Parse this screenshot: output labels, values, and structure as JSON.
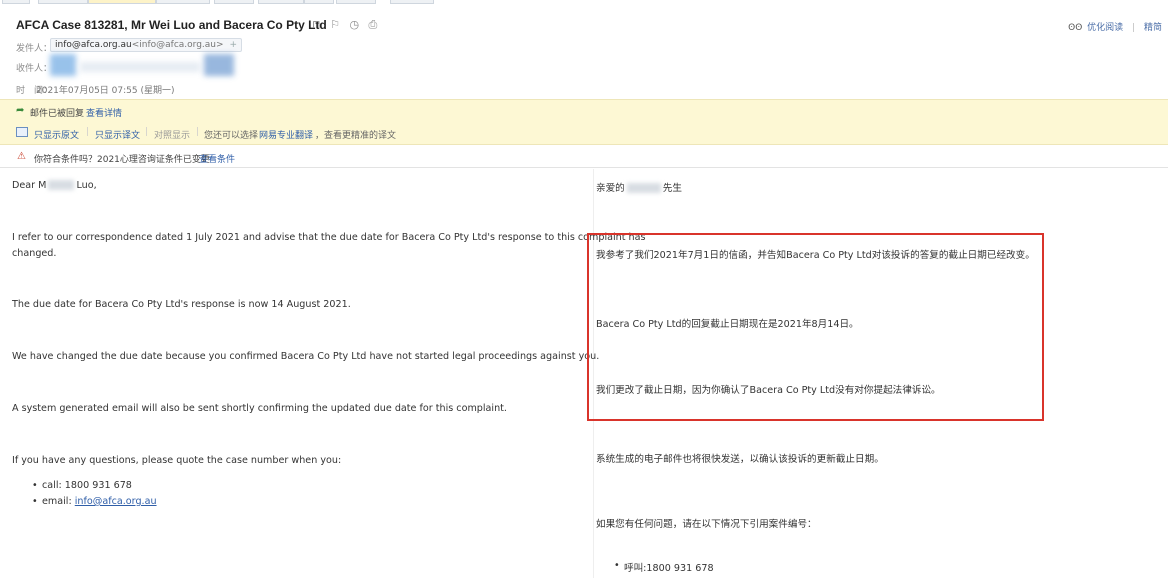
{
  "header": {
    "subject": "AFCA Case 813281, Mr Wei Luo and Bacera Co Pty Ltd",
    "subject_icons": "⊓ ⚐ ◷ ⎙",
    "optimize_read": "优化阅读",
    "simplified": "精简",
    "from_label": "发件人：",
    "from_name": "info@afca.org.au",
    "from_addr": "<info@afca.org.au>",
    "from_plus": "+",
    "to_label": "收件人：",
    "time_label": "时　间：",
    "time_value": "2021年07月05日 07:55 (星期一)"
  },
  "notices": {
    "replied_text": "邮件已被回复",
    "replied_link": "查看详情",
    "only_original": "只显示原文",
    "only_translation": "只显示译文",
    "side_by_side": "对照显示",
    "you_can_choose": "您还可以选择",
    "netease_translate": "网易专业翻译",
    "more_accurate": "，查看更精准的译文",
    "warning_text": "你符合条件吗？2021心理咨询证条件已变更",
    "warning_link": "查看条件"
  },
  "body_en": {
    "greeting_a": "Dear M",
    "greeting_b": "Luo,",
    "p1": "I refer to our correspondence dated 1 July 2021 and advise that the due date for Bacera Co Pty Ltd's response to this complaint has",
    "p1b": "changed.",
    "p2": "The due date for Bacera Co Pty Ltd's response is now 14 August 2021.",
    "p3": "We have changed the due date because you confirmed Bacera Co Pty Ltd have not started legal proceedings against you.",
    "p4": "A system generated email will also be sent shortly confirming the updated due date for this complaint.",
    "p5": "If you have any questions, please quote the case number when you:",
    "call": "call: 1800 931 678",
    "email_label": "email: ",
    "email_link": "info@afca.org.au"
  },
  "body_zh": {
    "greeting_a": "亲爱的",
    "greeting_b": "先生",
    "p1": "我参考了我们2021年7月1日的信函，并告知Bacera Co Pty Ltd对该投诉的答复的截止日期已经改变。",
    "p2": "Bacera Co Pty Ltd的回复截止日期现在是2021年8月14日。",
    "p3": "我们更改了截止日期，因为你确认了Bacera Co Pty Ltd没有对你提起法律诉讼。",
    "p4": "系统生成的电子邮件也将很快发送，以确认该投诉的更新截止日期。",
    "p5": "如果您有任何问题，请在以下情况下引用案件编号：",
    "call": "呼叫:1800 931 678"
  }
}
